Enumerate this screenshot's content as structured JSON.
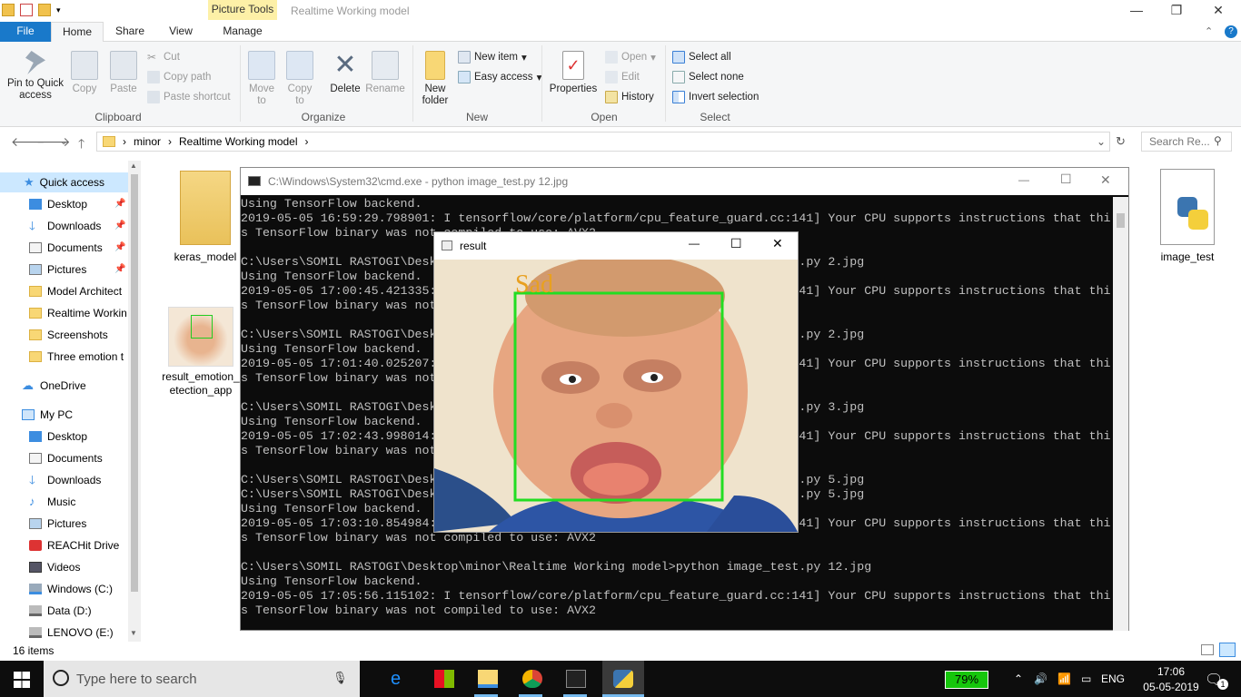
{
  "titlebar": {
    "context_tab": "Picture Tools",
    "title": "Realtime Working model",
    "min": "—",
    "max": "❐",
    "close": "✕"
  },
  "ribbon_tabs": {
    "file": "File",
    "home": "Home",
    "share": "Share",
    "view": "View",
    "manage": "Manage"
  },
  "ribbon": {
    "pin": "Pin to Quick access",
    "copy": "Copy",
    "paste": "Paste",
    "cut": "Cut",
    "copy_path": "Copy path",
    "paste_shortcut": "Paste shortcut",
    "move_to": "Move to",
    "copy_to": "Copy to",
    "delete": "Delete",
    "rename": "Rename",
    "new_folder": "New folder",
    "new_item": "New item",
    "easy_access": "Easy access",
    "properties": "Properties",
    "open": "Open",
    "edit": "Edit",
    "history": "History",
    "select_all": "Select all",
    "select_none": "Select none",
    "invert_selection": "Invert selection",
    "groups": {
      "clipboard": "Clipboard",
      "organize": "Organize",
      "new": "New",
      "open": "Open",
      "select": "Select"
    }
  },
  "address": {
    "crumbs": [
      "minor",
      "Realtime Working model"
    ],
    "sep": "›",
    "search_placeholder": "Search Re..."
  },
  "nav": {
    "quick_access": "Quick access",
    "qa_items": [
      "Desktop",
      "Downloads",
      "Documents",
      "Pictures",
      "Model Architect",
      "Realtime Workin",
      "Screenshots",
      "Three emotion t"
    ],
    "onedrive": "OneDrive",
    "mypc": "My PC",
    "pc_items": [
      "Desktop",
      "Documents",
      "Downloads",
      "Music",
      "Pictures",
      "REACHit Drive",
      "Videos",
      "Windows (C:)",
      "Data (D:)",
      "LENOVO (E:)"
    ]
  },
  "files": {
    "keras_model": "keras_model",
    "result_app": "result_emotion_detection_app",
    "result_app_line1": "result_emotion_",
    "result_app_line2": "etection_app",
    "image_test": "image_test"
  },
  "status": {
    "items": "16 items"
  },
  "cmd": {
    "title": "C:\\Windows\\System32\\cmd.exe - python  image_test.py 12.jpg",
    "lines": [
      "Using TensorFlow backend.",
      "2019-05-05 16:59:29.798901: I tensorflow/core/platform/cpu_feature_guard.cc:141] Your CPU supports instructions that thi",
      "s TensorFlow binary was not compiled to use: AVX2",
      "",
      "C:\\Users\\SOMIL RASTOGI\\Desktop\\minor\\Realtime Working model>python image_test.py 2.jpg",
      "Using TensorFlow backend.",
      "2019-05-05 17:00:45.421335: I tensorflow/core/platform/cpu_feature_guard.cc:141] Your CPU supports instructions that thi",
      "s TensorFlow binary was not compiled to use: AVX2",
      "",
      "C:\\Users\\SOMIL RASTOGI\\Desktop\\minor\\Realtime Working model>python image_test.py 2.jpg",
      "Using TensorFlow backend.",
      "2019-05-05 17:01:40.025207: I tensorflow/core/platform/cpu_feature_guard.cc:141] Your CPU supports instructions that thi",
      "s TensorFlow binary was not compiled to use: AVX2",
      "",
      "C:\\Users\\SOMIL RASTOGI\\Desktop\\minor\\Realtime Working model>python image_test.py 3.jpg",
      "Using TensorFlow backend.",
      "2019-05-05 17:02:43.998014: I tensorflow/core/platform/cpu_feature_guard.cc:141] Your CPU supports instructions that thi",
      "s TensorFlow binary was not compiled to use: AVX2",
      "",
      "C:\\Users\\SOMIL RASTOGI\\Desktop\\minor\\Realtime Working model>python image_test.py 5.jpg",
      "C:\\Users\\SOMIL RASTOGI\\Desktop\\minor\\Realtime Working model>python image_test.py 5.jpg",
      "Using TensorFlow backend.",
      "2019-05-05 17:03:10.854984: I tensorflow/core/platform/cpu_feature_guard.cc:141] Your CPU supports instructions that thi",
      "s TensorFlow binary was not compiled to use: AVX2",
      "",
      "C:\\Users\\SOMIL RASTOGI\\Desktop\\minor\\Realtime Working model>python image_test.py 12.jpg",
      "Using TensorFlow backend.",
      "2019-05-05 17:05:56.115102: I tensorflow/core/platform/cpu_feature_guard.cc:141] Your CPU supports instructions that thi",
      "s TensorFlow binary was not compiled to use: AVX2"
    ]
  },
  "result": {
    "title": "result",
    "label": "Sad",
    "label_color": "#e8a020",
    "box_color": "#22dd22"
  },
  "taskbar": {
    "search_placeholder": "Type here to search",
    "battery": "79%",
    "lang": "ENG",
    "time": "17:06",
    "date": "05-05-2019",
    "notif_count": "1"
  }
}
